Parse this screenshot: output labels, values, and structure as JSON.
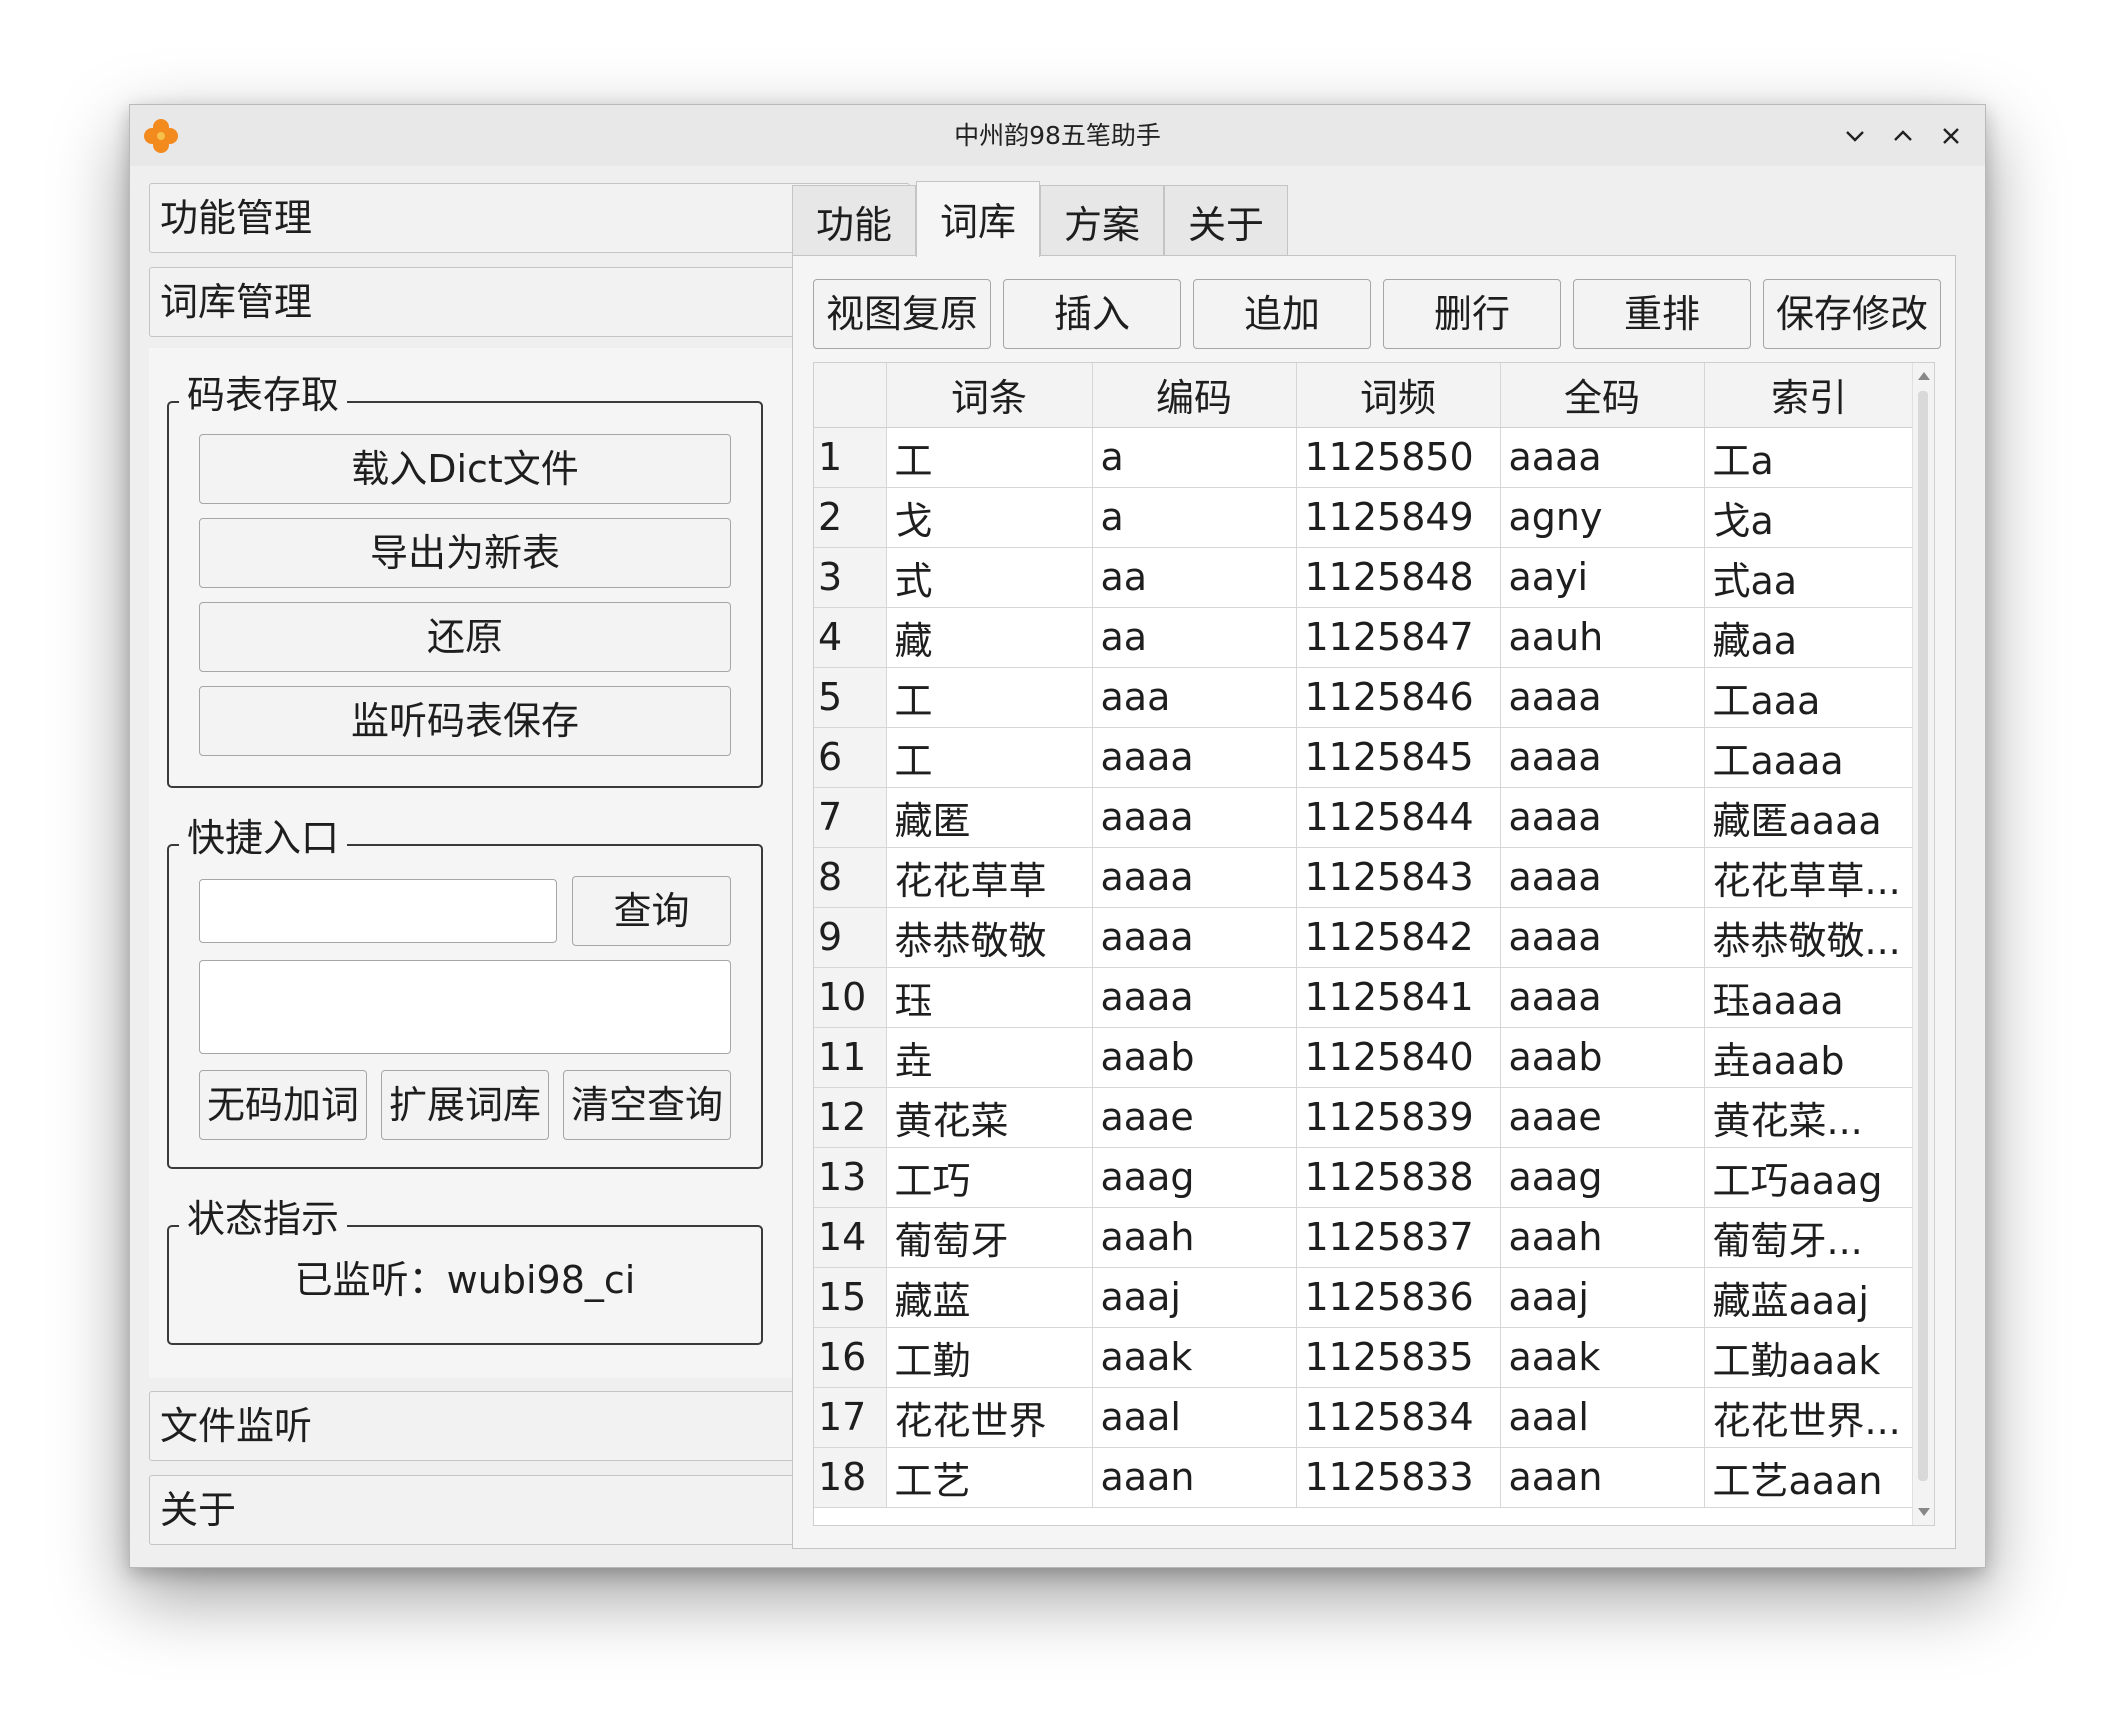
{
  "window": {
    "title": "中州韵98五笔助手",
    "controls": [
      "minimize",
      "maximize",
      "close"
    ]
  },
  "sidebar": {
    "sections": [
      {
        "label": "功能管理"
      },
      {
        "label": "词库管理"
      },
      {
        "label": "文件监听"
      },
      {
        "label": "关于"
      }
    ],
    "table_io": {
      "title": "码表存取",
      "buttons": [
        "载入Dict文件",
        "导出为新表",
        "还原",
        "监听码表保存"
      ]
    },
    "quick_entry": {
      "title": "快捷入口",
      "search_value": "",
      "query_button": "查询",
      "result_value": "",
      "buttons": [
        "无码加词",
        "扩展词库",
        "清空查询"
      ]
    },
    "status": {
      "title": "状态指示",
      "text": "已监听：wubi98_ci"
    }
  },
  "tabs": [
    {
      "label": "功能"
    },
    {
      "label": "词库",
      "active": true
    },
    {
      "label": "方案"
    },
    {
      "label": "关于"
    }
  ],
  "toolbar": {
    "buttons": [
      "视图复原",
      "插入",
      "追加",
      "删行",
      "重排",
      "保存修改"
    ]
  },
  "table": {
    "columns": [
      "词条",
      "编码",
      "词频",
      "全码",
      "索引"
    ],
    "rows": [
      [
        "1",
        "工",
        "a",
        "1125850",
        "aaaa",
        "工a"
      ],
      [
        "2",
        "戈",
        "a",
        "1125849",
        "agny",
        "戈a"
      ],
      [
        "3",
        "式",
        "aa",
        "1125848",
        "aayi",
        "式aa"
      ],
      [
        "4",
        "藏",
        "aa",
        "1125847",
        "aauh",
        "藏aa"
      ],
      [
        "5",
        "工",
        "aaa",
        "1125846",
        "aaaa",
        "工aaa"
      ],
      [
        "6",
        "工",
        "aaaa",
        "1125845",
        "aaaa",
        "工aaaa"
      ],
      [
        "7",
        "藏匿",
        "aaaa",
        "1125844",
        "aaaa",
        "藏匿aaaa"
      ],
      [
        "8",
        "花花草草",
        "aaaa",
        "1125843",
        "aaaa",
        "花花草草..."
      ],
      [
        "9",
        "恭恭敬敬",
        "aaaa",
        "1125842",
        "aaaa",
        "恭恭敬敬..."
      ],
      [
        "10",
        "珏",
        "aaaa",
        "1125841",
        "aaaa",
        "珏aaaa"
      ],
      [
        "11",
        "垚",
        "aaab",
        "1125840",
        "aaab",
        "垚aaab"
      ],
      [
        "12",
        "黄花菜",
        "aaae",
        "1125839",
        "aaae",
        "黄花菜..."
      ],
      [
        "13",
        "工巧",
        "aaag",
        "1125838",
        "aaag",
        "工巧aaag"
      ],
      [
        "14",
        "葡萄牙",
        "aaah",
        "1125837",
        "aaah",
        "葡萄牙..."
      ],
      [
        "15",
        "藏蓝",
        "aaaj",
        "1125836",
        "aaaj",
        "藏蓝aaaj"
      ],
      [
        "16",
        "工勤",
        "aaak",
        "1125835",
        "aaak",
        "工勤aaak"
      ],
      [
        "17",
        "花花世界",
        "aaal",
        "1125834",
        "aaal",
        "花花世界..."
      ],
      [
        "18",
        "工艺",
        "aaan",
        "1125833",
        "aaan",
        "工艺aaan"
      ]
    ]
  },
  "colors": {
    "window_bg": "#efefef",
    "panel_bg": "#f5f5f5",
    "border": "#c4c4c4",
    "table_header_bg": "#f3f3f3",
    "app_icon": "#f28a1d"
  }
}
